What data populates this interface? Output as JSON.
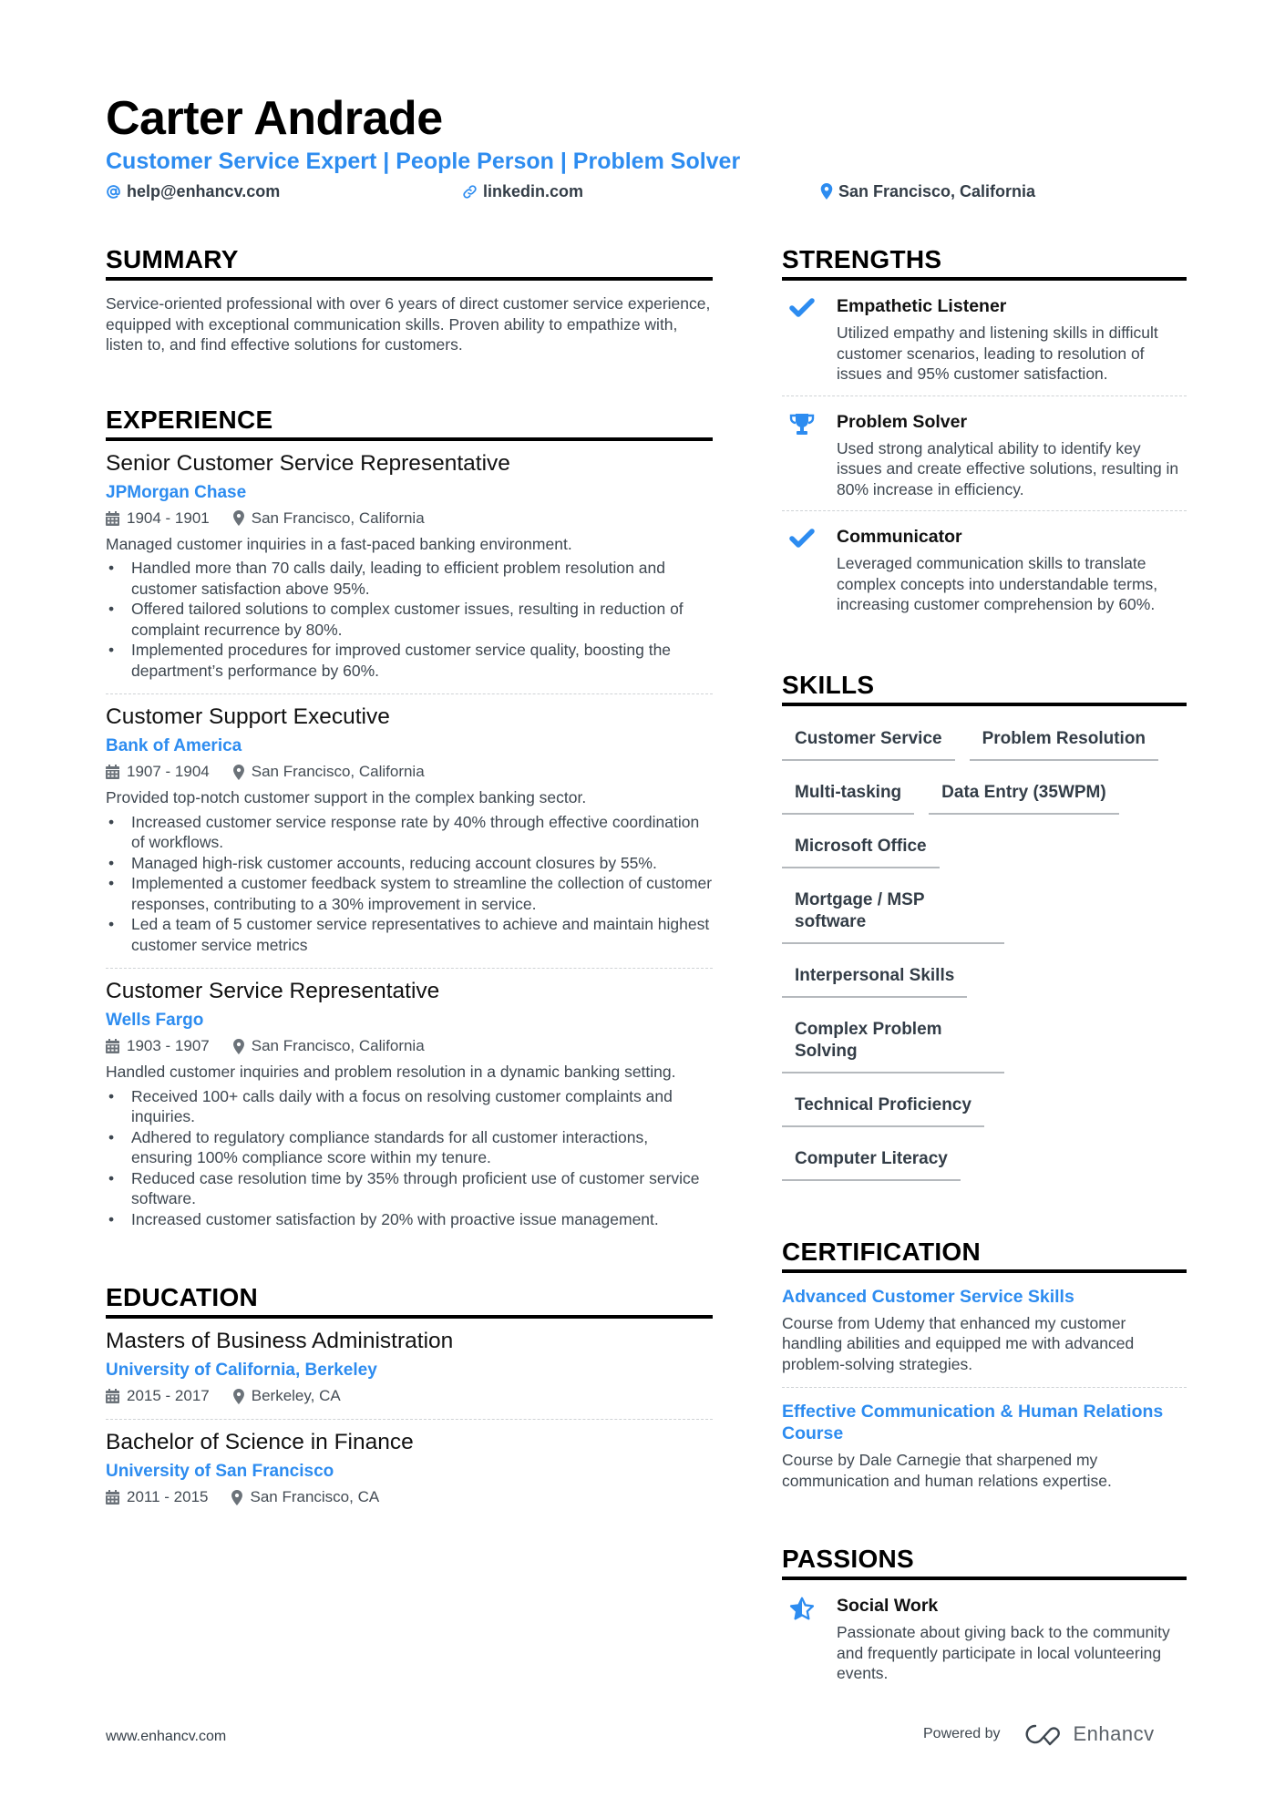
{
  "header": {
    "name": "Carter Andrade",
    "tagline": "Customer Service Expert | People Person | Problem Solver",
    "email": "help@enhancv.com",
    "link": "linkedin.com",
    "location": "San Francisco, California",
    "icons": {
      "email": "at-icon",
      "link": "link-icon",
      "location": "map-pin-icon"
    }
  },
  "colors": {
    "accent": "#2d8cf0",
    "heading": "#000000",
    "text": "#3e4750"
  },
  "summary": {
    "title": "SUMMARY",
    "text": "Service-oriented professional with over 6 years of direct customer service experience, equipped with exceptional communication skills. Proven ability to empathize with, listen to, and find effective solutions for customers."
  },
  "experience": {
    "title": "EXPERIENCE",
    "jobs": [
      {
        "title": "Senior Customer Service Representative",
        "company": "JPMorgan Chase",
        "dates": "1904 - 1901",
        "location": "San Francisco, California",
        "description": "Managed customer inquiries in a fast-paced banking environment.",
        "bullets": [
          "Handled more than 70 calls daily, leading to efficient problem resolution and customer satisfaction above 95%.",
          "Offered tailored solutions to complex customer issues, resulting in reduction of complaint recurrence by 80%.",
          "Implemented procedures for improved customer service quality, boosting the department’s performance by 60%."
        ]
      },
      {
        "title": "Customer Support Executive",
        "company": "Bank of America",
        "dates": "1907 - 1904",
        "location": "San Francisco, California",
        "description": "Provided top-notch customer support in the complex banking sector.",
        "bullets": [
          "Increased customer service response rate by 40% through effective coordination of workflows.",
          "Managed high-risk customer accounts, reducing account closures by 55%.",
          "Implemented a customer feedback system to streamline the collection of customer responses, contributing to a 30% improvement in service.",
          "Led a team of 5 customer service representatives to achieve and maintain highest customer service metrics"
        ]
      },
      {
        "title": "Customer Service Representative",
        "company": "Wells Fargo",
        "dates": "1903 - 1907",
        "location": "San Francisco, California",
        "description": "Handled customer inquiries and problem resolution in a dynamic banking setting.",
        "bullets": [
          "Received 100+ calls daily with a focus on resolving customer complaints and inquiries.",
          "Adhered to regulatory compliance standards for all customer interactions, ensuring 100% compliance score within my tenure.",
          "Reduced case resolution time by 35% through proficient use of customer service software.",
          "Increased customer satisfaction by 20% with proactive issue management."
        ]
      }
    ]
  },
  "education": {
    "title": "EDUCATION",
    "items": [
      {
        "degree": "Masters of Business Administration",
        "school": "University of California, Berkeley",
        "dates": "2015 - 2017",
        "location": "Berkeley, CA"
      },
      {
        "degree": "Bachelor of Science in Finance",
        "school": "University of San Francisco",
        "dates": "2011 - 2015",
        "location": "San Francisco, CA"
      }
    ]
  },
  "strengths": {
    "title": "STRENGTHS",
    "items": [
      {
        "icon": "checkmark-icon",
        "title": "Empathetic Listener",
        "description": "Utilized empathy and listening skills in difficult customer scenarios, leading to resolution of issues and 95% customer satisfaction."
      },
      {
        "icon": "trophy-icon",
        "title": "Problem Solver",
        "description": "Used strong analytical ability to identify key issues and create effective solutions, resulting in 80% increase in efficiency."
      },
      {
        "icon": "checkmark-icon",
        "title": "Communicator",
        "description": "Leveraged communication skills to translate complex concepts into understandable terms, increasing customer comprehension by 60%."
      }
    ]
  },
  "skills": {
    "title": "SKILLS",
    "items": [
      "Customer Service",
      "Problem Resolution",
      "Multi-tasking",
      "Data Entry (35WPM)",
      "Microsoft Office",
      "Mortgage / MSP software",
      "Interpersonal Skills",
      "Complex Problem Solving",
      "Technical Proficiency",
      "Computer Literacy"
    ]
  },
  "certification": {
    "title": "CERTIFICATION",
    "items": [
      {
        "title": "Advanced Customer Service Skills",
        "description": "Course from Udemy that enhanced my customer handling abilities and equipped me with advanced problem-solving strategies."
      },
      {
        "title": "Effective Communication & Human Relations Course",
        "description": "Course by Dale Carnegie that sharpened my communication and human relations expertise."
      }
    ]
  },
  "passions": {
    "title": "PASSIONS",
    "items": [
      {
        "icon": "star-icon",
        "title": "Social Work",
        "description": "Passionate about giving back to the community and frequently participate in local volunteering events."
      }
    ]
  },
  "footer": {
    "website": "www.enhancv.com",
    "powered_by": "Powered by",
    "brand": "Enhancv"
  }
}
